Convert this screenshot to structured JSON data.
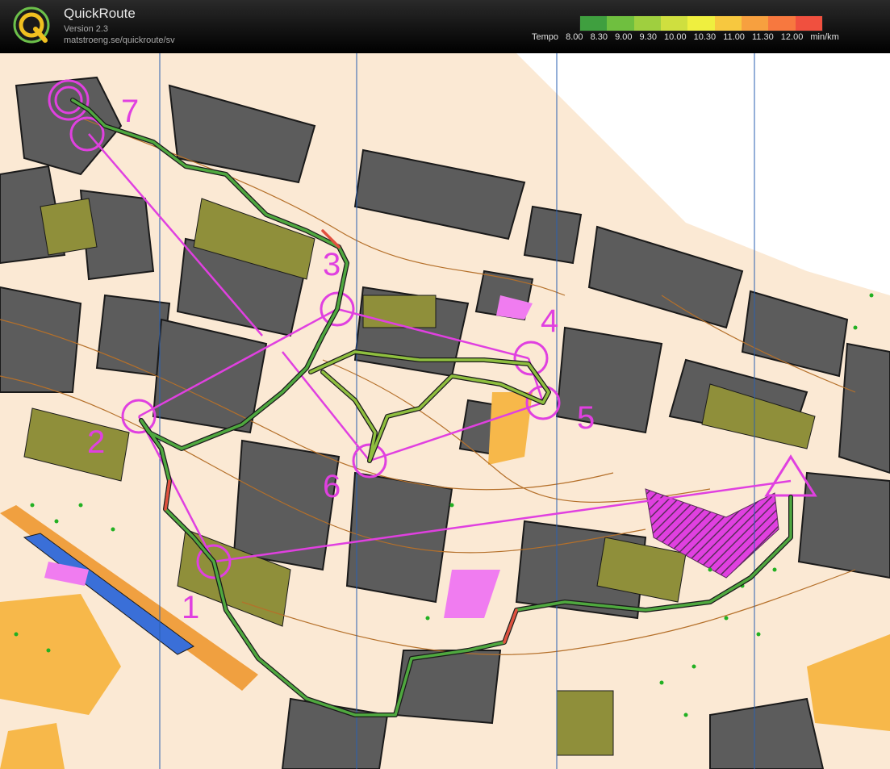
{
  "app": {
    "title": "QuickRoute",
    "version": "Version 2.3",
    "url": "matstroeng.se/quickroute/sv"
  },
  "legend": {
    "label": "Tempo",
    "ticks": [
      "8.00",
      "8.30",
      "9.00",
      "9.30",
      "10.00",
      "10.30",
      "11.00",
      "11.30",
      "12.00"
    ],
    "unit": "min/km",
    "colors": [
      "#3f9f3f",
      "#6fbf3f",
      "#9fcf3f",
      "#cfdf3f",
      "#efef3f",
      "#f7c83f",
      "#f7a03f",
      "#f7783f",
      "#f0503f"
    ]
  },
  "map": {
    "colors": {
      "background": "#fbe9d4",
      "building": "#5c5c5c",
      "vegetation": "#8f8f3a",
      "sand": "#f7b84a",
      "water_line": "#3a6fd8",
      "course": "#e040e0",
      "contour": "#b5702a",
      "meridian": "#2a5fb0"
    },
    "controls": [
      {
        "label": "1"
      },
      {
        "label": "2"
      },
      {
        "label": "3"
      },
      {
        "label": "4"
      },
      {
        "label": "5"
      },
      {
        "label": "6"
      },
      {
        "label": "7"
      }
    ]
  }
}
